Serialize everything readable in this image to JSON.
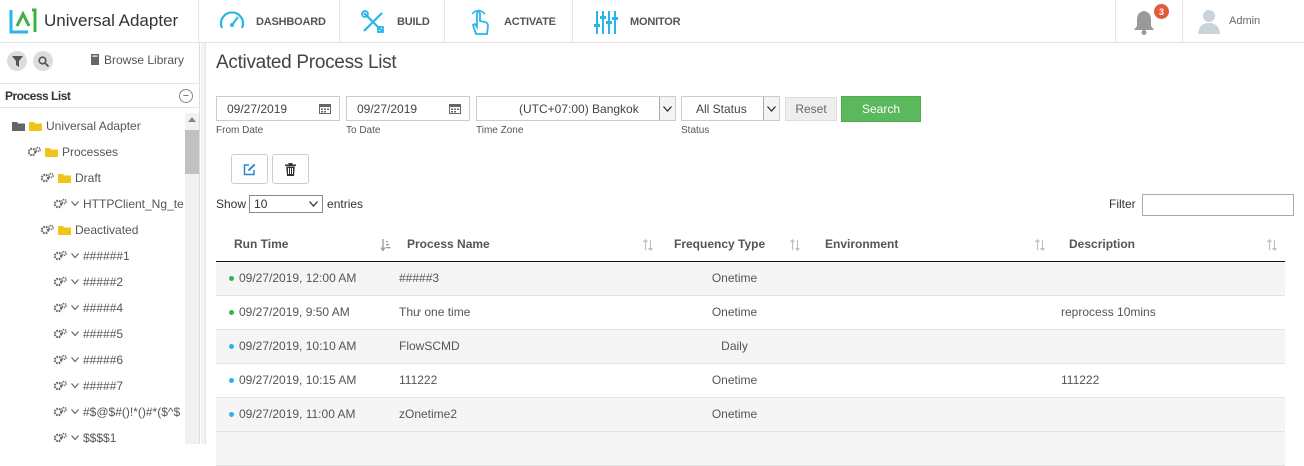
{
  "app": {
    "title": "Universal Adapter"
  },
  "nav": [
    {
      "label": "DASHBOARD",
      "icon": "speedometer-icon"
    },
    {
      "label": "BUILD",
      "icon": "tools-icon"
    },
    {
      "label": "ACTIVATE",
      "icon": "hand-pointer-icon"
    },
    {
      "label": "MONITOR",
      "icon": "sliders-icon"
    }
  ],
  "notifications": {
    "count": "3"
  },
  "user": {
    "name": "Admin"
  },
  "sidebar": {
    "browse_label": "Browse Library",
    "header": "Process List",
    "collapse": "−",
    "tree": [
      {
        "label": "Universal Adapter",
        "level": 0,
        "icons": "folders"
      },
      {
        "label": "Processes",
        "level": 1,
        "icons": "gears-folder"
      },
      {
        "label": "Draft",
        "level": 2,
        "icons": "gears-folder"
      },
      {
        "label": "HTTPClient_Ng_te",
        "level": 3,
        "icons": "gears-chevron"
      },
      {
        "label": "Deactivated",
        "level": 2,
        "icons": "gears-folder"
      },
      {
        "label": "######1",
        "level": 3,
        "icons": "gears-chevron"
      },
      {
        "label": "#####2",
        "level": 3,
        "icons": "gears-chevron"
      },
      {
        "label": "#####4",
        "level": 3,
        "icons": "gears-chevron"
      },
      {
        "label": "#####5",
        "level": 3,
        "icons": "gears-chevron"
      },
      {
        "label": "#####6",
        "level": 3,
        "icons": "gears-chevron"
      },
      {
        "label": "#####7",
        "level": 3,
        "icons": "gears-chevron"
      },
      {
        "label": "#$@$#()!*()#*($^$",
        "level": 3,
        "icons": "gears-chevron"
      },
      {
        "label": "$$$$1",
        "level": 3,
        "icons": "gears-chevron"
      }
    ]
  },
  "main": {
    "title": "Activated Process List",
    "from_date": {
      "value": "09/27/2019",
      "label": "From Date"
    },
    "to_date": {
      "value": "09/27/2019",
      "label": "To Date"
    },
    "time_zone": {
      "value": "(UTC+07:00) Bangkok",
      "label": "Time Zone"
    },
    "status": {
      "value": "All Status",
      "label": "Status"
    },
    "reset_label": "Reset",
    "search_label": "Search",
    "show_label": "Show",
    "entries_value": "10",
    "entries_label": "entries",
    "filter_label": "Filter",
    "columns": [
      "Run Time",
      "Process Name",
      "Frequency Type",
      "Environment",
      "Description"
    ],
    "rows": [
      {
        "status_color": "#3cb043",
        "run_time": "09/27/2019, 12:00 AM",
        "name": "#####3",
        "frequency": "Onetime",
        "environment": "",
        "description": ""
      },
      {
        "status_color": "#3cb043",
        "run_time": "09/27/2019, 9:50 AM",
        "name": "Thư one time",
        "frequency": "Onetime",
        "environment": "",
        "description": "reprocess 10mins"
      },
      {
        "status_color": "#2ab5e8",
        "run_time": "09/27/2019, 10:10 AM",
        "name": "FlowSCMD",
        "frequency": "Daily",
        "environment": "",
        "description": ""
      },
      {
        "status_color": "#2ab5e8",
        "run_time": "09/27/2019, 10:15 AM",
        "name": "111222",
        "frequency": "Onetime",
        "environment": "",
        "description": "111222"
      },
      {
        "status_color": "#2ab5e8",
        "run_time": "09/27/2019, 11:00 AM",
        "name": "zOnetime2",
        "frequency": "Onetime",
        "environment": "",
        "description": ""
      }
    ]
  },
  "colors": {
    "accent": "#2ab5e8",
    "search": "#5cb85c",
    "badge": "#e45b3c"
  }
}
